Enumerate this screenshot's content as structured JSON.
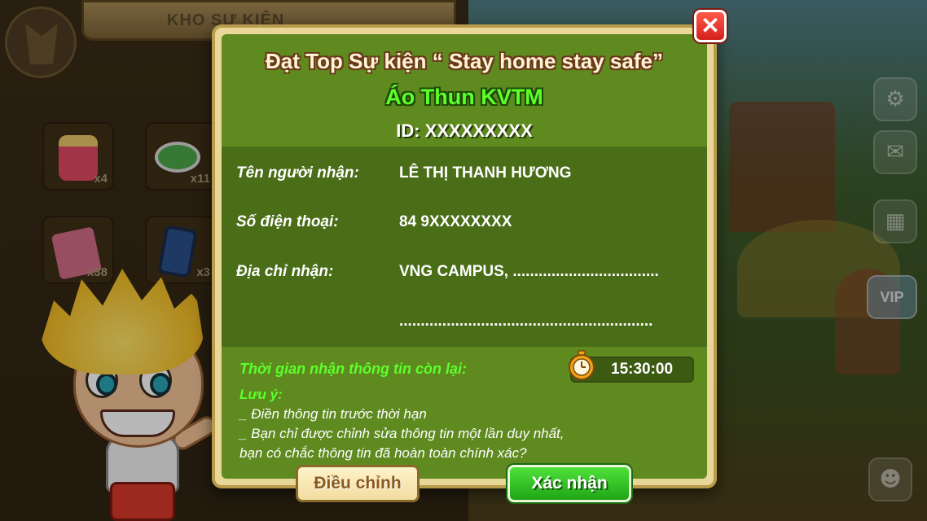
{
  "background": {
    "panel_title": "KHO SỰ KIỆN",
    "inventory": [
      {
        "icon": "jar-icon",
        "count": "x4"
      },
      {
        "icon": "bottle-cap-icon",
        "count": "x11"
      },
      {
        "icon": "book-icon",
        "count": "x38"
      },
      {
        "icon": "phone-icon",
        "count": "x3"
      }
    ],
    "vip_label": "VIP"
  },
  "dialog": {
    "title": "Đạt Top Sự kiện “ Stay home stay safe”",
    "prize_name": "Áo Thun KVTM",
    "prize_id": "ID: XXXXXXXXX",
    "fields": {
      "recipient_label": "Tên người nhận:",
      "recipient_value": "LÊ THỊ THANH HƯƠNG",
      "phone_label": "Số điện thoại:",
      "phone_value": "84 9XXXXXXXX",
      "address_label": "Địa chỉ nhận:",
      "address_line1": "VNG CAMPUS, ..................................",
      "address_line2": "..........................................................."
    },
    "timer": {
      "label": "Thời gian nhận thông tin còn lại:",
      "value": "15:30:00"
    },
    "notes": {
      "title": "Lưu ý:",
      "line1": "_ Điền thông tin trước thời hạn",
      "line2": "_ Bạn chỉ được chỉnh sửa thông tin một lần duy nhất,",
      "line3": "bạn có chắc thông tin đã hoàn toàn chính xác?"
    },
    "buttons": {
      "edit": "Điều chỉnh",
      "confirm": "Xác nhận"
    }
  },
  "colors": {
    "dialog_bg": "#5e8a1f",
    "highlight_green": "#5dff2b",
    "confirm_green": "#1fa516",
    "close_red": "#d4201a"
  }
}
